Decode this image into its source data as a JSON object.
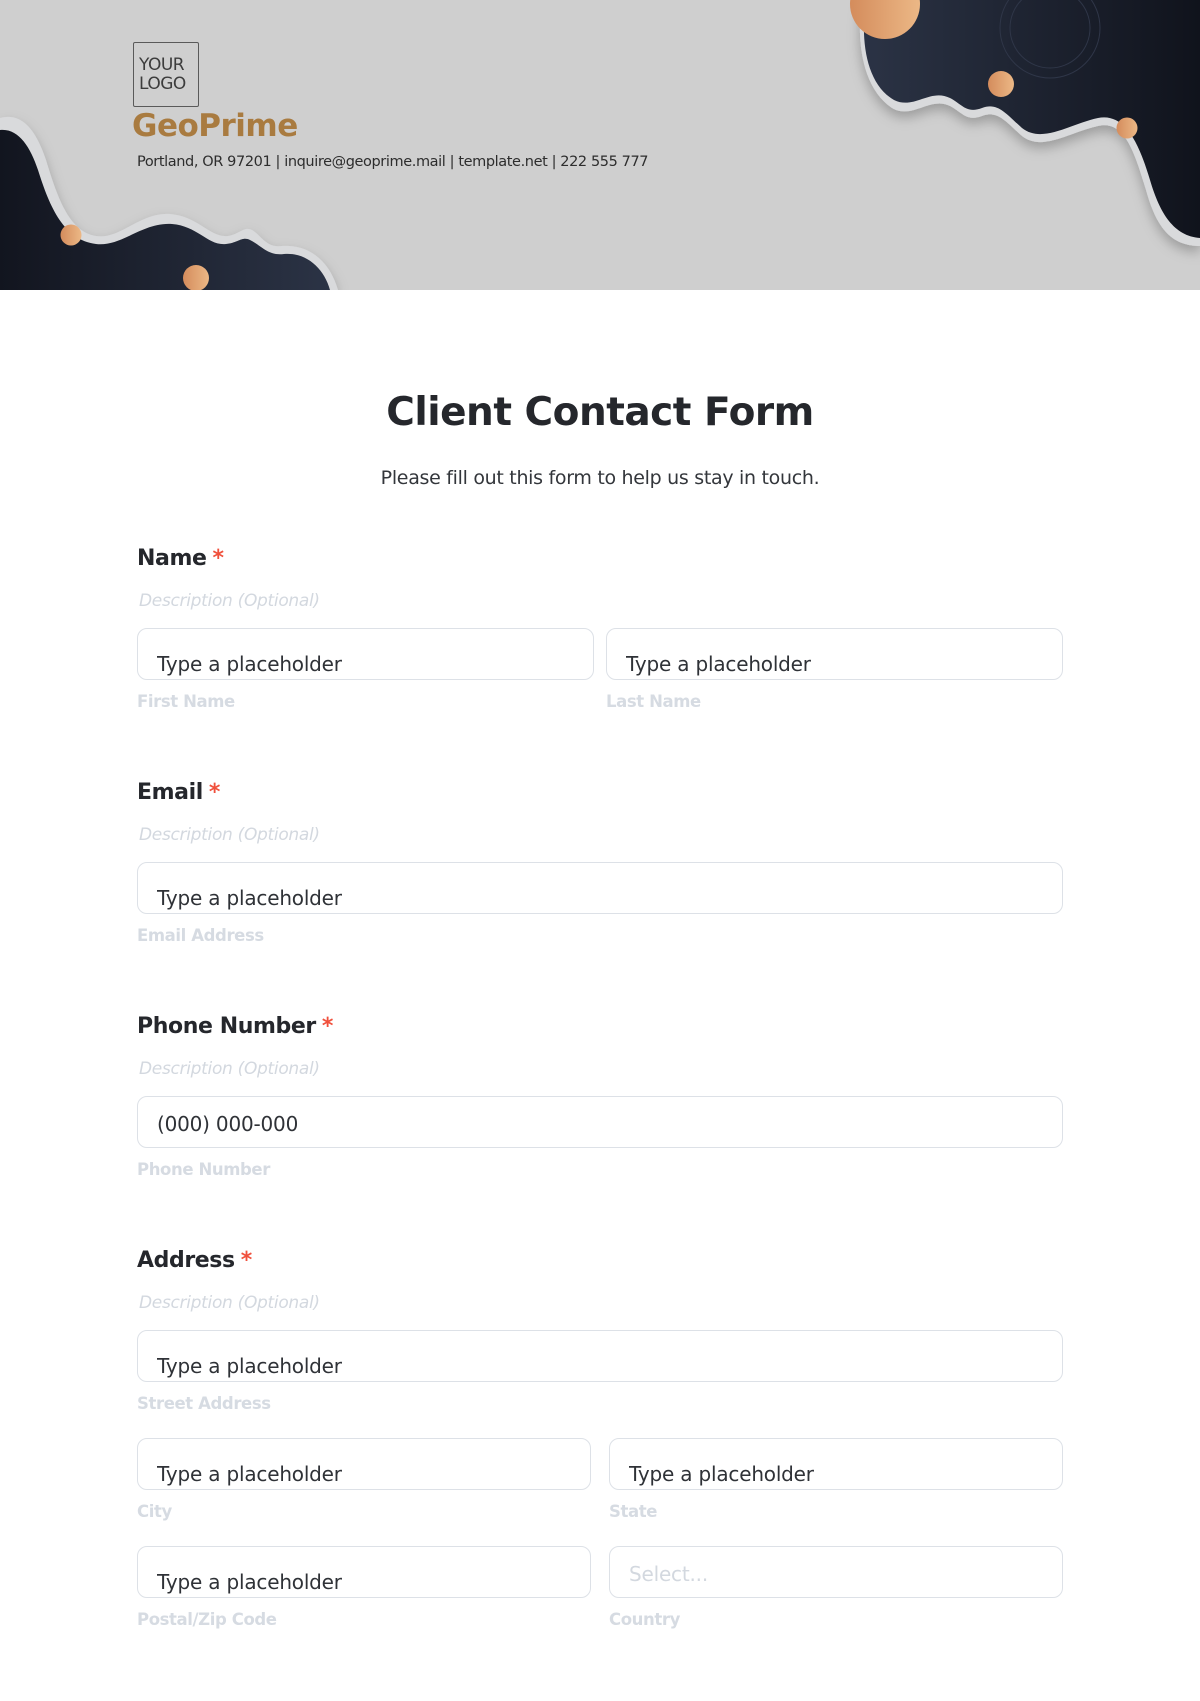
{
  "header": {
    "logo_line1": "YOUR",
    "logo_line2": "LOGO",
    "brand": "GeoPrime",
    "contact_line": "Portland, OR 97201 | inquire@geoprime.mail | template.net | 222 555 777",
    "colors": {
      "background": "#cfcfcf",
      "brand": "#a97b40",
      "blob": "#1c2130",
      "accent_dot": "#e0a06c"
    }
  },
  "form": {
    "title": "Client Contact Form",
    "subtitle": "Please fill out this form to help us stay in touch.",
    "required_marker": "*",
    "questions": [
      {
        "label": "Name",
        "description": "Description (Optional)",
        "fields": [
          {
            "value": "Type a placeholder",
            "sublabel": "First Name"
          },
          {
            "value": "Type a placeholder",
            "sublabel": "Last Name"
          }
        ]
      },
      {
        "label": "Email",
        "description": "Description (Optional)",
        "fields": [
          {
            "value": "Type a placeholder",
            "sublabel": "Email Address"
          }
        ]
      },
      {
        "label": "Phone Number",
        "description": "Description (Optional)",
        "fields": [
          {
            "value": "(000) 000-000",
            "sublabel": "Phone Number"
          }
        ]
      },
      {
        "label": "Address",
        "description": "Description (Optional)",
        "fields": [
          {
            "value": "Type a placeholder",
            "sublabel": "Street Address"
          },
          {
            "value": "Type a placeholder",
            "sublabel": "City"
          },
          {
            "value": "Type a placeholder",
            "sublabel": "State"
          },
          {
            "value": "Type a placeholder",
            "sublabel": "Postal/Zip Code"
          },
          {
            "placeholder": "Select...",
            "sublabel": "Country"
          }
        ]
      }
    ]
  }
}
